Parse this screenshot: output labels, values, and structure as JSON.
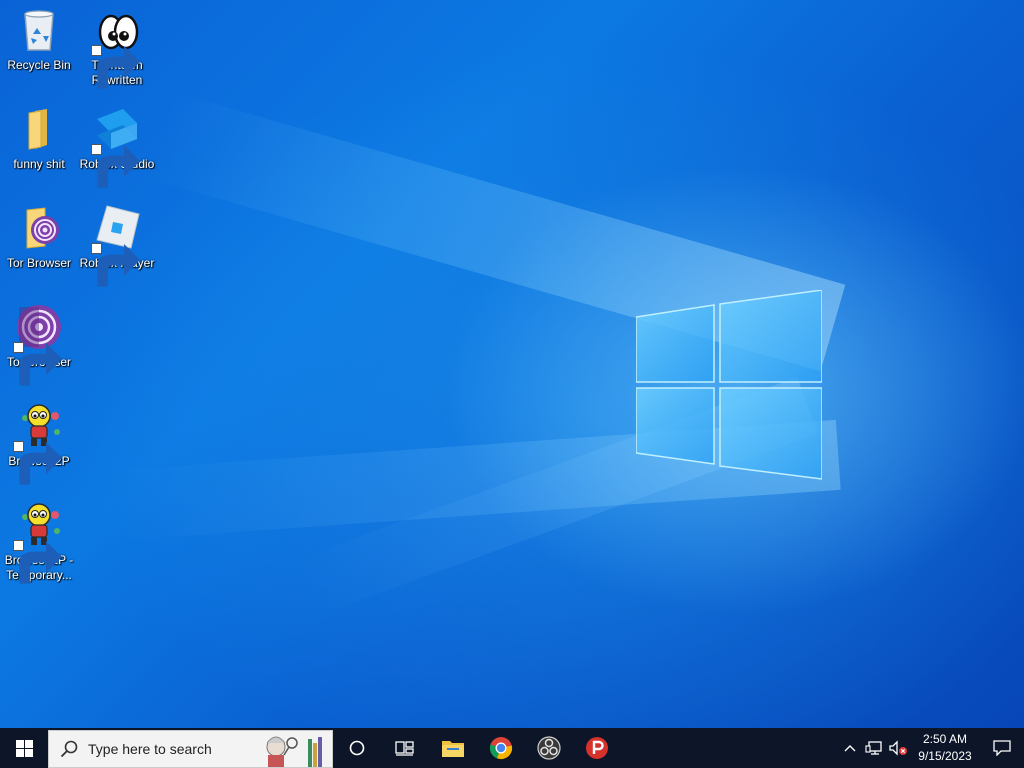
{
  "desktop": {
    "icons": [
      {
        "id": "recycle-bin",
        "label": "Recycle Bin",
        "icon": "recycle-bin-icon"
      },
      {
        "id": "toontown",
        "label": "Toontown Rewritten",
        "icon": "toontown-icon"
      },
      {
        "id": "funny-folder",
        "label": "funny shit",
        "icon": "folder-icon"
      },
      {
        "id": "roblox-studio",
        "label": "Roblox Studio",
        "icon": "roblox-studio-icon"
      },
      {
        "id": "tor-folder",
        "label": "Tor Browser",
        "icon": "tor-folder-icon"
      },
      {
        "id": "roblox-player",
        "label": "Roblox Player",
        "icon": "roblox-player-icon"
      },
      {
        "id": "tor-browser",
        "label": "Tor Browser",
        "icon": "tor-browser-icon"
      },
      {
        "id": "browse-i2p",
        "label": "Browse I2P",
        "icon": "i2p-icon"
      },
      {
        "id": "browse-i2p-temp",
        "label": "Browse I2P - Temporary...",
        "icon": "i2p-icon"
      }
    ]
  },
  "taskbar": {
    "search_placeholder": "Type here to search",
    "pinned": [
      "cortana-icon",
      "task-view-icon",
      "file-explorer-icon",
      "chrome-icon",
      "obs-icon",
      "psiphon-icon"
    ],
    "clock": {
      "time": "2:50 AM",
      "date": "9/15/2023"
    },
    "tray": [
      "show-hidden-icons-chevron",
      "network-icon",
      "volume-muted-icon"
    ]
  },
  "colors": {
    "taskbar_bg": "#0d1629",
    "wallpaper_blue": "#0a63d6",
    "logo_glow": "#7fd4ff"
  }
}
